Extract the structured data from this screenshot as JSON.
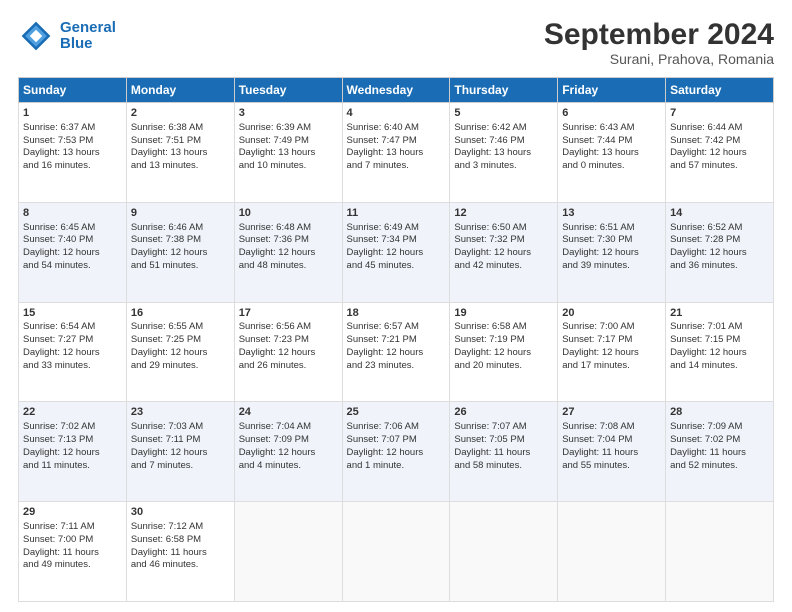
{
  "header": {
    "logo_line1": "General",
    "logo_line2": "Blue",
    "month": "September 2024",
    "location": "Surani, Prahova, Romania"
  },
  "days_of_week": [
    "Sunday",
    "Monday",
    "Tuesday",
    "Wednesday",
    "Thursday",
    "Friday",
    "Saturday"
  ],
  "weeks": [
    [
      {
        "day": "1",
        "info": "Sunrise: 6:37 AM\nSunset: 7:53 PM\nDaylight: 13 hours\nand 16 minutes."
      },
      {
        "day": "2",
        "info": "Sunrise: 6:38 AM\nSunset: 7:51 PM\nDaylight: 13 hours\nand 13 minutes."
      },
      {
        "day": "3",
        "info": "Sunrise: 6:39 AM\nSunset: 7:49 PM\nDaylight: 13 hours\nand 10 minutes."
      },
      {
        "day": "4",
        "info": "Sunrise: 6:40 AM\nSunset: 7:47 PM\nDaylight: 13 hours\nand 7 minutes."
      },
      {
        "day": "5",
        "info": "Sunrise: 6:42 AM\nSunset: 7:46 PM\nDaylight: 13 hours\nand 3 minutes."
      },
      {
        "day": "6",
        "info": "Sunrise: 6:43 AM\nSunset: 7:44 PM\nDaylight: 13 hours\nand 0 minutes."
      },
      {
        "day": "7",
        "info": "Sunrise: 6:44 AM\nSunset: 7:42 PM\nDaylight: 12 hours\nand 57 minutes."
      }
    ],
    [
      {
        "day": "8",
        "info": "Sunrise: 6:45 AM\nSunset: 7:40 PM\nDaylight: 12 hours\nand 54 minutes."
      },
      {
        "day": "9",
        "info": "Sunrise: 6:46 AM\nSunset: 7:38 PM\nDaylight: 12 hours\nand 51 minutes."
      },
      {
        "day": "10",
        "info": "Sunrise: 6:48 AM\nSunset: 7:36 PM\nDaylight: 12 hours\nand 48 minutes."
      },
      {
        "day": "11",
        "info": "Sunrise: 6:49 AM\nSunset: 7:34 PM\nDaylight: 12 hours\nand 45 minutes."
      },
      {
        "day": "12",
        "info": "Sunrise: 6:50 AM\nSunset: 7:32 PM\nDaylight: 12 hours\nand 42 minutes."
      },
      {
        "day": "13",
        "info": "Sunrise: 6:51 AM\nSunset: 7:30 PM\nDaylight: 12 hours\nand 39 minutes."
      },
      {
        "day": "14",
        "info": "Sunrise: 6:52 AM\nSunset: 7:28 PM\nDaylight: 12 hours\nand 36 minutes."
      }
    ],
    [
      {
        "day": "15",
        "info": "Sunrise: 6:54 AM\nSunset: 7:27 PM\nDaylight: 12 hours\nand 33 minutes."
      },
      {
        "day": "16",
        "info": "Sunrise: 6:55 AM\nSunset: 7:25 PM\nDaylight: 12 hours\nand 29 minutes."
      },
      {
        "day": "17",
        "info": "Sunrise: 6:56 AM\nSunset: 7:23 PM\nDaylight: 12 hours\nand 26 minutes."
      },
      {
        "day": "18",
        "info": "Sunrise: 6:57 AM\nSunset: 7:21 PM\nDaylight: 12 hours\nand 23 minutes."
      },
      {
        "day": "19",
        "info": "Sunrise: 6:58 AM\nSunset: 7:19 PM\nDaylight: 12 hours\nand 20 minutes."
      },
      {
        "day": "20",
        "info": "Sunrise: 7:00 AM\nSunset: 7:17 PM\nDaylight: 12 hours\nand 17 minutes."
      },
      {
        "day": "21",
        "info": "Sunrise: 7:01 AM\nSunset: 7:15 PM\nDaylight: 12 hours\nand 14 minutes."
      }
    ],
    [
      {
        "day": "22",
        "info": "Sunrise: 7:02 AM\nSunset: 7:13 PM\nDaylight: 12 hours\nand 11 minutes."
      },
      {
        "day": "23",
        "info": "Sunrise: 7:03 AM\nSunset: 7:11 PM\nDaylight: 12 hours\nand 7 minutes."
      },
      {
        "day": "24",
        "info": "Sunrise: 7:04 AM\nSunset: 7:09 PM\nDaylight: 12 hours\nand 4 minutes."
      },
      {
        "day": "25",
        "info": "Sunrise: 7:06 AM\nSunset: 7:07 PM\nDaylight: 12 hours\nand 1 minute."
      },
      {
        "day": "26",
        "info": "Sunrise: 7:07 AM\nSunset: 7:05 PM\nDaylight: 11 hours\nand 58 minutes."
      },
      {
        "day": "27",
        "info": "Sunrise: 7:08 AM\nSunset: 7:04 PM\nDaylight: 11 hours\nand 55 minutes."
      },
      {
        "day": "28",
        "info": "Sunrise: 7:09 AM\nSunset: 7:02 PM\nDaylight: 11 hours\nand 52 minutes."
      }
    ],
    [
      {
        "day": "29",
        "info": "Sunrise: 7:11 AM\nSunset: 7:00 PM\nDaylight: 11 hours\nand 49 minutes."
      },
      {
        "day": "30",
        "info": "Sunrise: 7:12 AM\nSunset: 6:58 PM\nDaylight: 11 hours\nand 46 minutes."
      },
      {
        "day": "",
        "info": ""
      },
      {
        "day": "",
        "info": ""
      },
      {
        "day": "",
        "info": ""
      },
      {
        "day": "",
        "info": ""
      },
      {
        "day": "",
        "info": ""
      }
    ]
  ]
}
